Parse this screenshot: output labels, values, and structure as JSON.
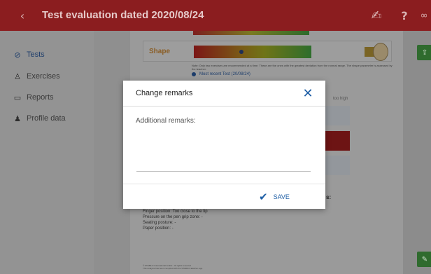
{
  "header": {
    "back_icon": "chevron-left-icon",
    "title": "Test evaluation dated 2020/08/24",
    "sign_icon": "signature-pen-icon",
    "help_label": "?",
    "link_icon": "link-icon"
  },
  "sidebar": {
    "items": [
      {
        "label": "Tests",
        "icon": "pen-circle-icon",
        "active": true
      },
      {
        "label": "Exercises",
        "icon": "person-exercise-icon",
        "active": false
      },
      {
        "label": "Reports",
        "icon": "folder-icon",
        "active": false
      },
      {
        "label": "Profile data",
        "icon": "person-icon",
        "active": false
      }
    ]
  },
  "document": {
    "shape_label": "Shape",
    "note": "Note: Only two exercises are recommended at a time. These are the ones with the greatest deviation from the normal range. The shape parameter is assessed by the teacher.",
    "most_recent": "Most recent Test (20/08/24)",
    "too_high": "too high",
    "s_label": "s:",
    "findings": [
      "Finger position: Too close to the tip",
      "Pressure on the pen grip zone: -",
      "Seating posture: -",
      "Paper position: -"
    ],
    "footer_1": "© STABILO International GmbH - All rights reserved",
    "footer_2": "This analysis has been compiled with the STABILO EduPen app."
  },
  "modal": {
    "title": "Change remarks",
    "close_icon": "close-icon",
    "field_label": "Additional remarks:",
    "field_value": "",
    "save_label": "SAVE",
    "save_icon": "checkmark-icon"
  },
  "colors": {
    "header_bg": "#8b1d1f",
    "accent_blue": "#1f5fa6",
    "green_button": "#2f6b2e"
  }
}
